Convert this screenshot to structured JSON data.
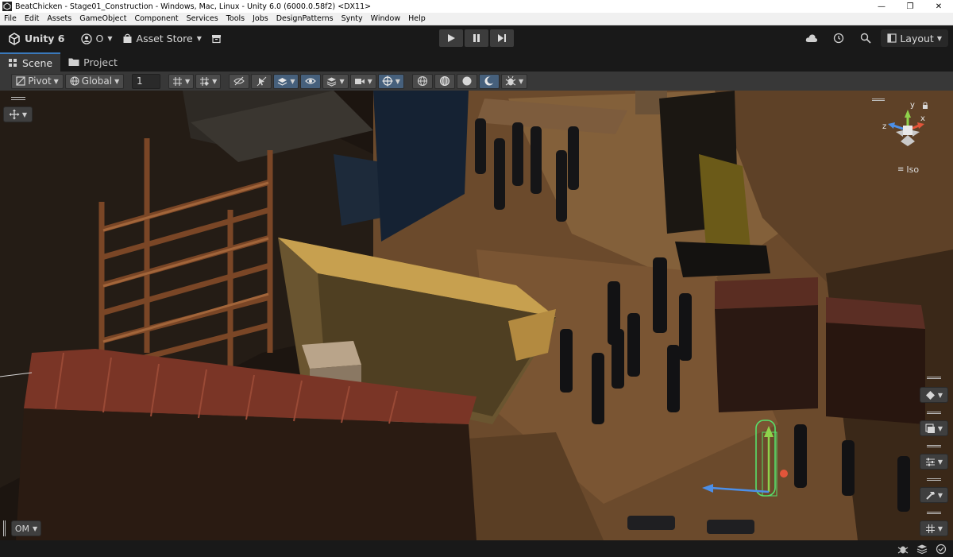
{
  "window": {
    "title": "BeatChicken - Stage01_Construction - Windows, Mac, Linux - Unity 6.0 (6000.0.58f2) <DX11>",
    "controls": [
      "minimize",
      "maximize",
      "close"
    ]
  },
  "menu": [
    "File",
    "Edit",
    "Assets",
    "GameObject",
    "Component",
    "Services",
    "Tools",
    "Jobs",
    "DesignPatterns",
    "Synty",
    "Window",
    "Help"
  ],
  "toolbar": {
    "product": "Unity 6",
    "account": "O",
    "asset_store": "Asset Store",
    "layout": "Layout"
  },
  "tabs": [
    {
      "label": "Scene",
      "active": true
    },
    {
      "label": "Project",
      "active": false
    }
  ],
  "scene_toolbar": {
    "pivot": "Pivot",
    "space": "Global",
    "grid_size": "1"
  },
  "scene": {
    "projection": "Iso",
    "axes": {
      "x": "x",
      "y": "y",
      "z": "z"
    },
    "overlay_menu": "OM"
  },
  "colors": {
    "accent": "#3a79bb",
    "toggle_on": "#46607c",
    "gizmo_x": "#e2553a",
    "gizmo_y": "#8fd24b",
    "gizmo_z": "#4c8fe8"
  }
}
